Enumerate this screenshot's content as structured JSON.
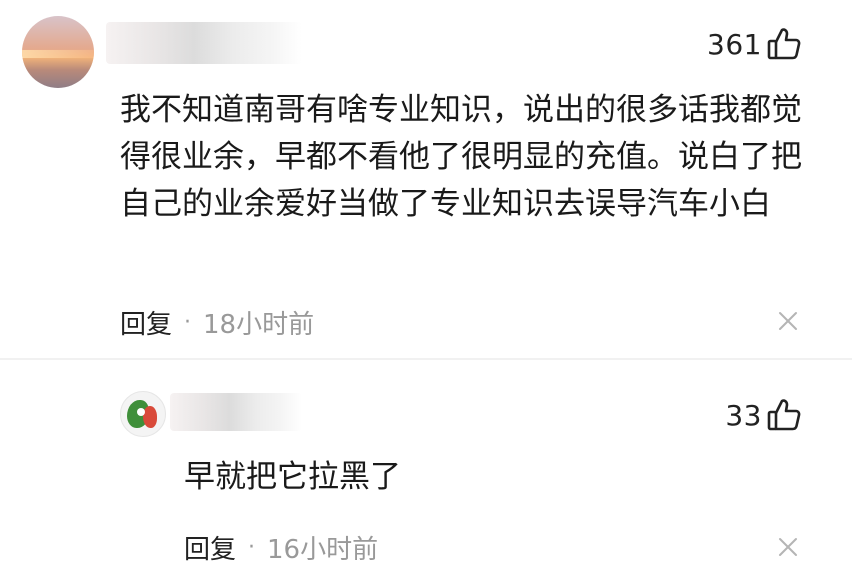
{
  "comments": [
    {
      "like_count": "361",
      "text": "我不知道南哥有啥专业知识，说出的很多话我都觉得很业余，早都不看他了很明显的充值。说白了把自己的业余爱好当做了专业知识去误导汽车小白",
      "reply_label": "回复",
      "separator": "·",
      "timestamp": "18小时前"
    },
    {
      "like_count": "33",
      "text": "早就把它拉黑了",
      "reply_label": "回复",
      "separator": "·",
      "timestamp": "16小时前"
    }
  ],
  "icons": {
    "like": "thumbs-up-icon",
    "close": "close-icon"
  },
  "colors": {
    "text_primary": "#222222",
    "text_secondary": "#999999"
  }
}
